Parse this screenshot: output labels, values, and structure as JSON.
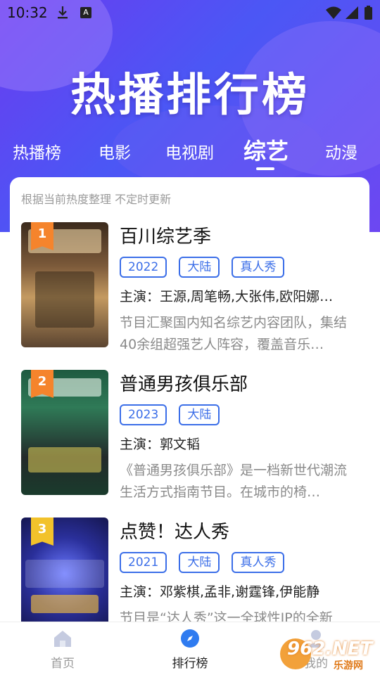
{
  "statusbar": {
    "time": "10:32",
    "a_label": "A"
  },
  "header": {
    "title": "热播排行榜"
  },
  "tabs": [
    {
      "label": "热播榜"
    },
    {
      "label": "电影"
    },
    {
      "label": "电视剧"
    },
    {
      "label": "综艺",
      "active": true
    },
    {
      "label": "动漫"
    }
  ],
  "list": {
    "hint": "根据当前热度整理 不定时更新",
    "items": [
      {
        "rank": "1",
        "title": "百川综艺季",
        "tags": [
          "2022",
          "大陆",
          "真人秀"
        ],
        "cast": "主演：王源,周笔畅,大张伟,欧阳娜…",
        "desc": "节目汇聚国内知名综艺内容团队，集结40余组超强艺人阵容，覆盖音乐…"
      },
      {
        "rank": "2",
        "title": "普通男孩俱乐部",
        "tags": [
          "2023",
          "大陆"
        ],
        "cast": "主演：郭文韬",
        "desc": "《普通男孩俱乐部》是一档新世代潮流生活方式指南节目。在城市的椅…"
      },
      {
        "rank": "3",
        "title": "点赞！达人秀",
        "tags": [
          "2021",
          "大陆",
          "真人秀"
        ],
        "cast": "主演：邓紫棋,孟非,谢霆锋,伊能静",
        "desc": "节目是“达人秀”这一全球性IP的全新"
      }
    ]
  },
  "bottom_nav": [
    {
      "label": "首页",
      "icon": "home-icon"
    },
    {
      "label": "排行榜",
      "icon": "compass-icon",
      "active": true
    },
    {
      "label": "我的",
      "icon": "user-icon"
    }
  ],
  "watermark": {
    "text": "962.NET",
    "subtext": "乐游网"
  },
  "colors": {
    "accent": "#3b6ee8",
    "hero_start": "#6a3cf0",
    "hero_end": "#4b57f5",
    "rank_orange": "#f5842c",
    "rank_yellow": "#f2c22b"
  }
}
